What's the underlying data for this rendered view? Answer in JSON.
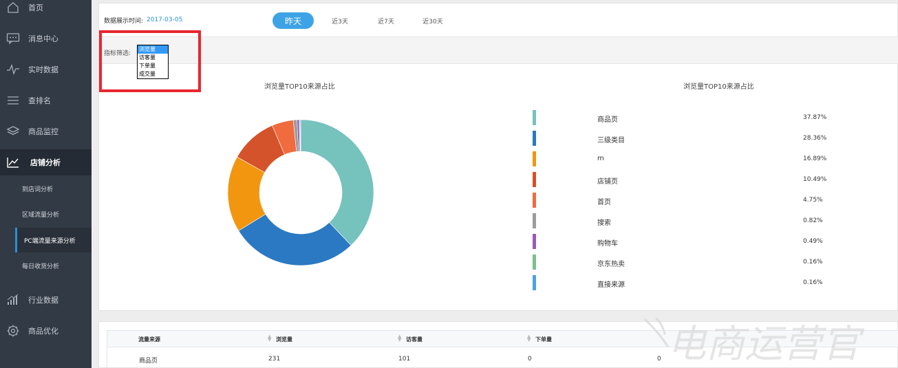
{
  "sidebar": {
    "items": [
      {
        "label": "首页",
        "icon": "home-icon"
      },
      {
        "label": "消息中心",
        "icon": "message-icon"
      },
      {
        "label": "实时数据",
        "icon": "pulse-icon"
      },
      {
        "label": "查排名",
        "icon": "list-icon"
      },
      {
        "label": "商品监控",
        "icon": "layers-icon"
      },
      {
        "label": "店铺分析",
        "icon": "trend-icon"
      }
    ],
    "sub_items": [
      {
        "label": "到店词分析"
      },
      {
        "label": "区域流量分析"
      },
      {
        "label": "PC端流量来源分析"
      },
      {
        "label": "每日收货分析"
      }
    ],
    "bottom_items": [
      {
        "label": "行业数据",
        "icon": "bar-chart-icon"
      },
      {
        "label": "商品优化",
        "icon": "gear-icon"
      }
    ]
  },
  "header": {
    "date_label": "数据展示时间:",
    "date_value": "2017-03-05",
    "ranges": [
      "昨天",
      "近3天",
      "近7天",
      "近30天"
    ],
    "active_range": "昨天"
  },
  "filter": {
    "label": "指标筛选:",
    "options": [
      "浏览量",
      "访客量",
      "下单量",
      "成交量"
    ],
    "selected": "浏览量"
  },
  "chart_titles": {
    "left": "浏览量TOP10来源占比",
    "right": "浏览量TOP10来源占比"
  },
  "chart_data": {
    "type": "pie",
    "title": "浏览量TOP10来源占比",
    "categories": [
      "商品页",
      "三级类目",
      "m",
      "店铺页",
      "首页",
      "搜索",
      "购物车",
      "京东热卖",
      "直接来源"
    ],
    "values": [
      37.87,
      28.36,
      16.89,
      10.49,
      4.75,
      0.82,
      0.49,
      0.16,
      0.16
    ],
    "labels": [
      "37.87%",
      "28.36%",
      "16.89%",
      "10.49%",
      "4.75%",
      "0.82%",
      "0.49%",
      "0.16%",
      "0.16%"
    ],
    "colors": [
      "#76c2bd",
      "#2b79c2",
      "#f2960f",
      "#d5532a",
      "#f06b3e",
      "#9c9c9c",
      "#9b59b6",
      "#7dbf8f",
      "#4da3e0"
    ],
    "unit": "%"
  },
  "table": {
    "headers": [
      "流量来源",
      "浏览量",
      "访客量",
      "下单量"
    ],
    "rows": [
      [
        "商品页",
        "231",
        "101",
        "0",
        "0"
      ]
    ]
  },
  "watermark": "电商运营官"
}
